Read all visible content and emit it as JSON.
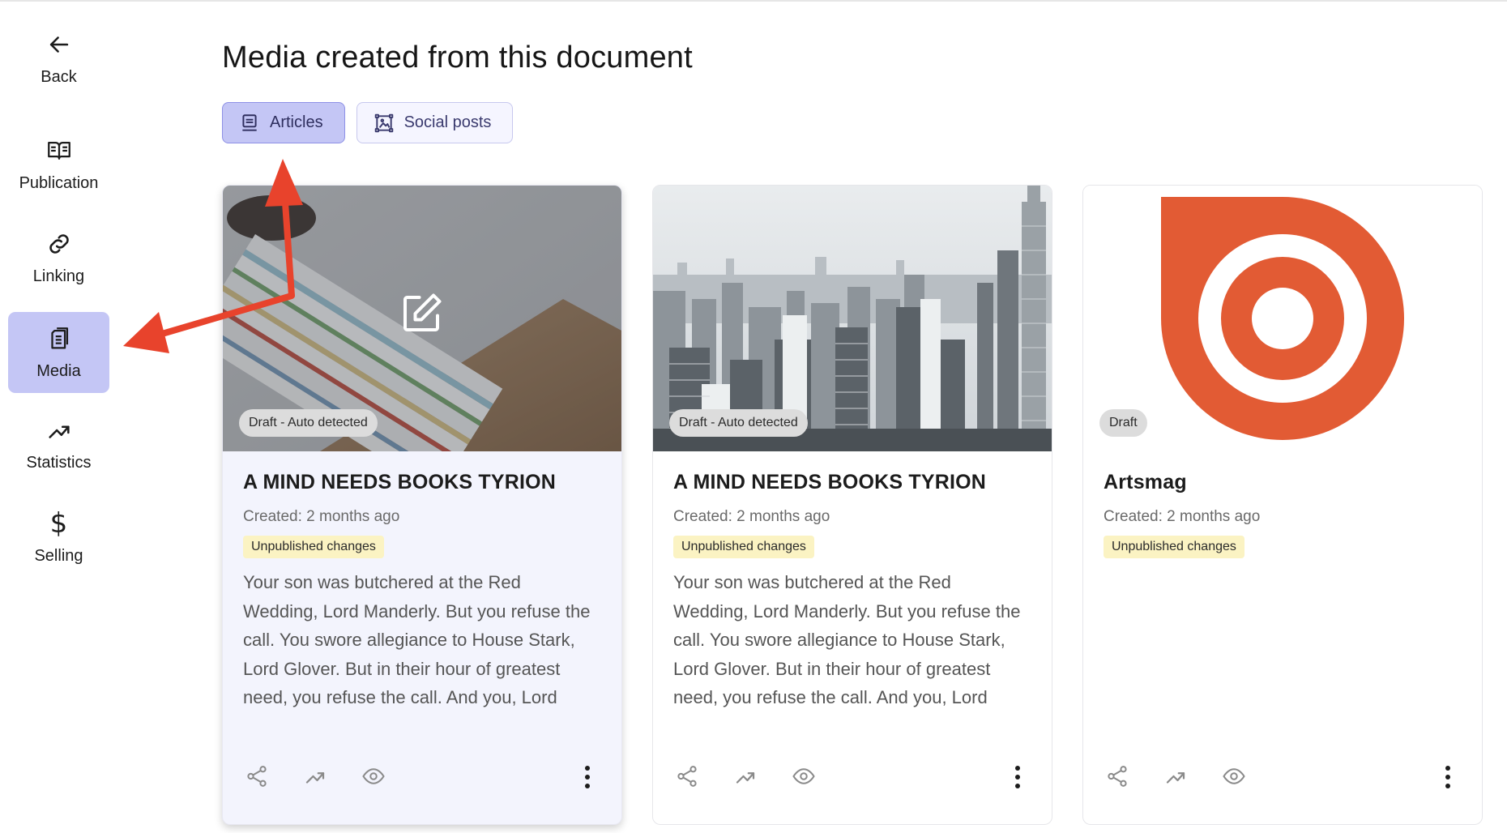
{
  "sidebar": {
    "items": [
      {
        "label": "Back",
        "icon": "arrow-left-icon"
      },
      {
        "label": "Publication",
        "icon": "book-open-icon"
      },
      {
        "label": "Linking",
        "icon": "link-icon"
      },
      {
        "label": "Media",
        "icon": "documents-icon",
        "active": true
      },
      {
        "label": "Statistics",
        "icon": "trend-up-icon"
      },
      {
        "label": "Selling",
        "icon": "dollar-icon"
      }
    ]
  },
  "main": {
    "title": "Media created from this document",
    "tabs": [
      {
        "label": "Articles",
        "icon": "article-icon",
        "active": true
      },
      {
        "label": "Social posts",
        "icon": "image-frame-icon",
        "active": false
      }
    ]
  },
  "cards": [
    {
      "badge": "Draft - Auto detected",
      "title": "A MIND NEEDS BOOKS TYRION",
      "created": "Created: 2 months ago",
      "status": "Unpublished changes",
      "excerpt": "Your son was butchered at the Red Wedding, Lord Manderly. But you refuse the call. You swore allegiance to House Stark, Lord Glover. But in their hour of greatest need, you refuse the call. And you, Lord Kerwin, your father was skinned",
      "image": "books-photo",
      "overlay_icon": "edit-icon"
    },
    {
      "badge": "Draft - Auto detected",
      "title": "A MIND NEEDS BOOKS TYRION",
      "created": "Created: 2 months ago",
      "status": "Unpublished changes",
      "excerpt": "Your son was butchered at the Red Wedding, Lord Manderly. But you refuse the call. You swore allegiance to House Stark, Lord Glover. But in their hour of greatest need, you refuse the call. And you, Lord Kerwin, your father was skinned",
      "image": "city-skyline-photo"
    },
    {
      "badge": "Draft",
      "title": "Artsmag",
      "created": "Created: 2 months ago",
      "status": "Unpublished changes",
      "excerpt": "",
      "image": "artsmag-logo",
      "logo_color": "#e25b34"
    }
  ],
  "colors": {
    "accent": "#c4c6f5",
    "annotation_arrow": "#e8432c",
    "pill": "#fbf3c3"
  }
}
